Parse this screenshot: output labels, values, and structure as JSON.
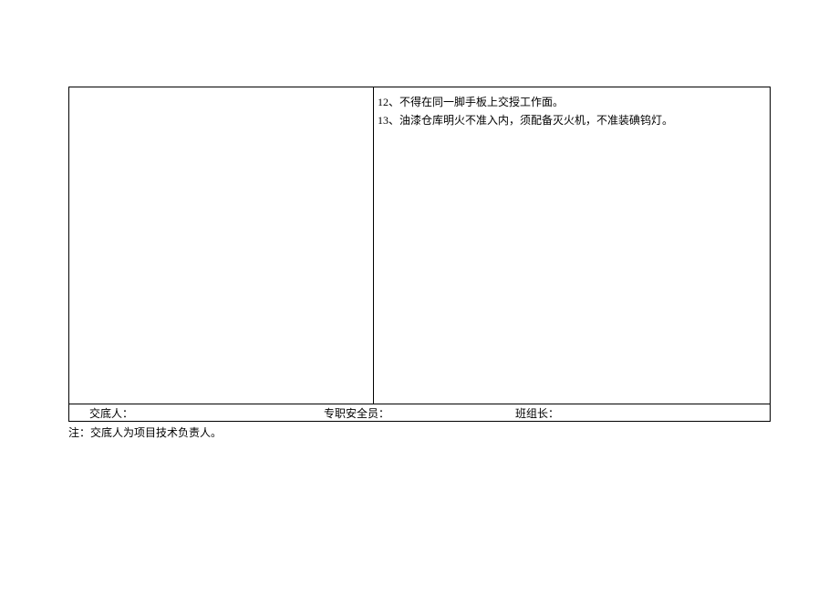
{
  "content": {
    "line12": "12、不得在同一脚手板上交授工作面。",
    "line13": "13、油漆仓库明火不准入内，须配备灭火机，不准装碘钨灯。"
  },
  "signatures": {
    "person1_label": "交底人：",
    "person2_label": "专职安全员：",
    "person3_label": "班组长："
  },
  "note": "注：交底人为项目技术负责人。"
}
